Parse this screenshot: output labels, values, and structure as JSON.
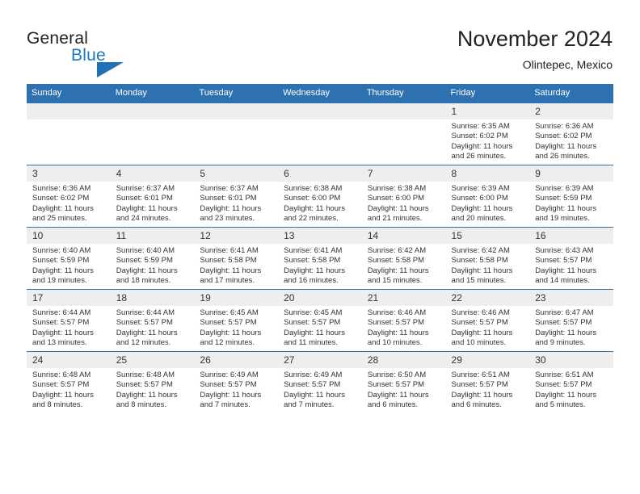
{
  "logo": {
    "word1": "General",
    "word2": "Blue",
    "triangle_color": "#1f72b5"
  },
  "header": {
    "title": "November 2024",
    "location": "Olintepec, Mexico"
  },
  "theme": {
    "header_blue": "#2d71b0",
    "daynum_gray": "#eeeeee",
    "text": "#333333"
  },
  "weekday_headers": [
    "Sunday",
    "Monday",
    "Tuesday",
    "Wednesday",
    "Thursday",
    "Friday",
    "Saturday"
  ],
  "weeks": [
    [
      {
        "day": "",
        "empty": true
      },
      {
        "day": "",
        "empty": true
      },
      {
        "day": "",
        "empty": true
      },
      {
        "day": "",
        "empty": true
      },
      {
        "day": "",
        "empty": true
      },
      {
        "day": "1",
        "sunrise": "Sunrise: 6:35 AM",
        "sunset": "Sunset: 6:02 PM",
        "daylight": "Daylight: 11 hours and 26 minutes."
      },
      {
        "day": "2",
        "sunrise": "Sunrise: 6:36 AM",
        "sunset": "Sunset: 6:02 PM",
        "daylight": "Daylight: 11 hours and 26 minutes."
      }
    ],
    [
      {
        "day": "3",
        "sunrise": "Sunrise: 6:36 AM",
        "sunset": "Sunset: 6:02 PM",
        "daylight": "Daylight: 11 hours and 25 minutes."
      },
      {
        "day": "4",
        "sunrise": "Sunrise: 6:37 AM",
        "sunset": "Sunset: 6:01 PM",
        "daylight": "Daylight: 11 hours and 24 minutes."
      },
      {
        "day": "5",
        "sunrise": "Sunrise: 6:37 AM",
        "sunset": "Sunset: 6:01 PM",
        "daylight": "Daylight: 11 hours and 23 minutes."
      },
      {
        "day": "6",
        "sunrise": "Sunrise: 6:38 AM",
        "sunset": "Sunset: 6:00 PM",
        "daylight": "Daylight: 11 hours and 22 minutes."
      },
      {
        "day": "7",
        "sunrise": "Sunrise: 6:38 AM",
        "sunset": "Sunset: 6:00 PM",
        "daylight": "Daylight: 11 hours and 21 minutes."
      },
      {
        "day": "8",
        "sunrise": "Sunrise: 6:39 AM",
        "sunset": "Sunset: 6:00 PM",
        "daylight": "Daylight: 11 hours and 20 minutes."
      },
      {
        "day": "9",
        "sunrise": "Sunrise: 6:39 AM",
        "sunset": "Sunset: 5:59 PM",
        "daylight": "Daylight: 11 hours and 19 minutes."
      }
    ],
    [
      {
        "day": "10",
        "sunrise": "Sunrise: 6:40 AM",
        "sunset": "Sunset: 5:59 PM",
        "daylight": "Daylight: 11 hours and 19 minutes."
      },
      {
        "day": "11",
        "sunrise": "Sunrise: 6:40 AM",
        "sunset": "Sunset: 5:59 PM",
        "daylight": "Daylight: 11 hours and 18 minutes."
      },
      {
        "day": "12",
        "sunrise": "Sunrise: 6:41 AM",
        "sunset": "Sunset: 5:58 PM",
        "daylight": "Daylight: 11 hours and 17 minutes."
      },
      {
        "day": "13",
        "sunrise": "Sunrise: 6:41 AM",
        "sunset": "Sunset: 5:58 PM",
        "daylight": "Daylight: 11 hours and 16 minutes."
      },
      {
        "day": "14",
        "sunrise": "Sunrise: 6:42 AM",
        "sunset": "Sunset: 5:58 PM",
        "daylight": "Daylight: 11 hours and 15 minutes."
      },
      {
        "day": "15",
        "sunrise": "Sunrise: 6:42 AM",
        "sunset": "Sunset: 5:58 PM",
        "daylight": "Daylight: 11 hours and 15 minutes."
      },
      {
        "day": "16",
        "sunrise": "Sunrise: 6:43 AM",
        "sunset": "Sunset: 5:57 PM",
        "daylight": "Daylight: 11 hours and 14 minutes."
      }
    ],
    [
      {
        "day": "17",
        "sunrise": "Sunrise: 6:44 AM",
        "sunset": "Sunset: 5:57 PM",
        "daylight": "Daylight: 11 hours and 13 minutes."
      },
      {
        "day": "18",
        "sunrise": "Sunrise: 6:44 AM",
        "sunset": "Sunset: 5:57 PM",
        "daylight": "Daylight: 11 hours and 12 minutes."
      },
      {
        "day": "19",
        "sunrise": "Sunrise: 6:45 AM",
        "sunset": "Sunset: 5:57 PM",
        "daylight": "Daylight: 11 hours and 12 minutes."
      },
      {
        "day": "20",
        "sunrise": "Sunrise: 6:45 AM",
        "sunset": "Sunset: 5:57 PM",
        "daylight": "Daylight: 11 hours and 11 minutes."
      },
      {
        "day": "21",
        "sunrise": "Sunrise: 6:46 AM",
        "sunset": "Sunset: 5:57 PM",
        "daylight": "Daylight: 11 hours and 10 minutes."
      },
      {
        "day": "22",
        "sunrise": "Sunrise: 6:46 AM",
        "sunset": "Sunset: 5:57 PM",
        "daylight": "Daylight: 11 hours and 10 minutes."
      },
      {
        "day": "23",
        "sunrise": "Sunrise: 6:47 AM",
        "sunset": "Sunset: 5:57 PM",
        "daylight": "Daylight: 11 hours and 9 minutes."
      }
    ],
    [
      {
        "day": "24",
        "sunrise": "Sunrise: 6:48 AM",
        "sunset": "Sunset: 5:57 PM",
        "daylight": "Daylight: 11 hours and 8 minutes."
      },
      {
        "day": "25",
        "sunrise": "Sunrise: 6:48 AM",
        "sunset": "Sunset: 5:57 PM",
        "daylight": "Daylight: 11 hours and 8 minutes."
      },
      {
        "day": "26",
        "sunrise": "Sunrise: 6:49 AM",
        "sunset": "Sunset: 5:57 PM",
        "daylight": "Daylight: 11 hours and 7 minutes."
      },
      {
        "day": "27",
        "sunrise": "Sunrise: 6:49 AM",
        "sunset": "Sunset: 5:57 PM",
        "daylight": "Daylight: 11 hours and 7 minutes."
      },
      {
        "day": "28",
        "sunrise": "Sunrise: 6:50 AM",
        "sunset": "Sunset: 5:57 PM",
        "daylight": "Daylight: 11 hours and 6 minutes."
      },
      {
        "day": "29",
        "sunrise": "Sunrise: 6:51 AM",
        "sunset": "Sunset: 5:57 PM",
        "daylight": "Daylight: 11 hours and 6 minutes."
      },
      {
        "day": "30",
        "sunrise": "Sunrise: 6:51 AM",
        "sunset": "Sunset: 5:57 PM",
        "daylight": "Daylight: 11 hours and 5 minutes."
      }
    ]
  ]
}
